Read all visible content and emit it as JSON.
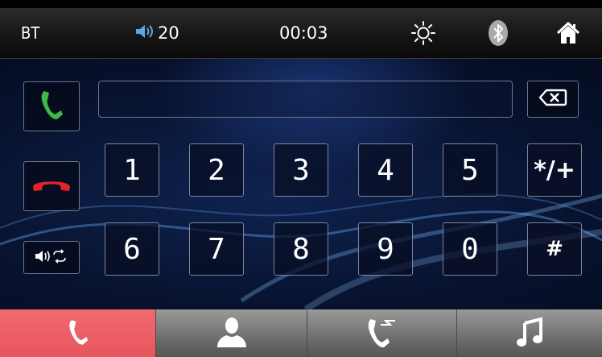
{
  "status_bar": {
    "source_label": "BT",
    "volume_level": "20",
    "call_time": "00:03",
    "icons": [
      "speaker-icon",
      "brightness-icon",
      "bluetooth-icon",
      "home-icon"
    ]
  },
  "dialer": {
    "number": "",
    "keys": [
      "1",
      "2",
      "3",
      "4",
      "5",
      "*/+",
      "6",
      "7",
      "8",
      "9",
      "0",
      "#"
    ],
    "side_buttons": [
      "call-icon",
      "hang-up-icon",
      "audio-switch-icon"
    ]
  },
  "tabs": [
    {
      "icon": "phone-icon",
      "active": true
    },
    {
      "icon": "contacts-icon",
      "active": false
    },
    {
      "icon": "call-log-icon",
      "active": false
    },
    {
      "icon": "music-icon",
      "active": false
    }
  ],
  "colors": {
    "accept": "#3fb84a",
    "reject": "#e2232a",
    "active_tab": "#ec6167",
    "tab_bar": "#7a7a7a"
  }
}
